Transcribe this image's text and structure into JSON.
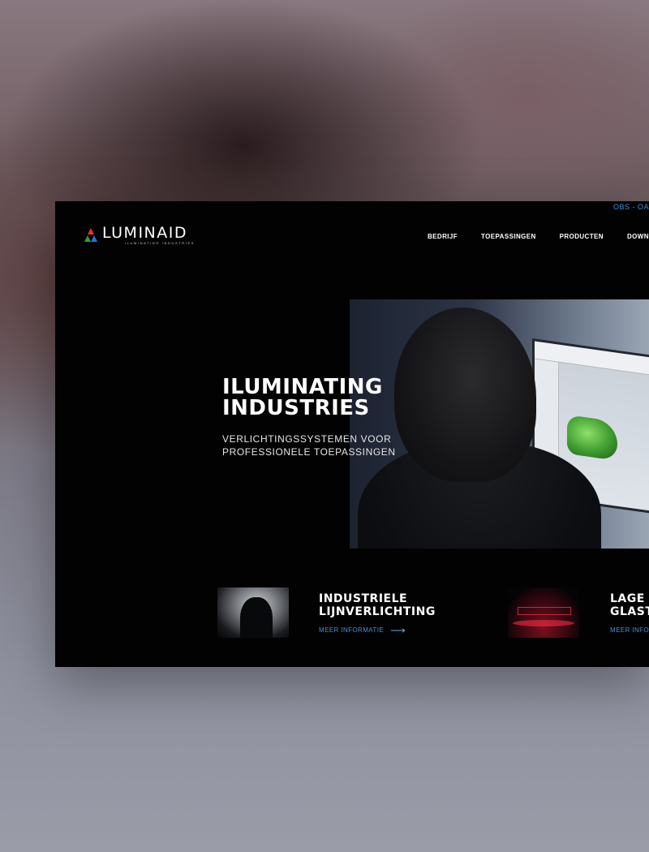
{
  "topbar": {
    "link_text": "OBS - OA"
  },
  "header": {
    "logo": {
      "name": "LUMINAID",
      "tagline": "ILUMINATING INDUSTRIES"
    },
    "nav": [
      {
        "label": "BEDRIJF"
      },
      {
        "label": "TOEPASSINGEN"
      },
      {
        "label": "PRODUCTEN"
      },
      {
        "label": "DOWNLO"
      }
    ]
  },
  "hero": {
    "title": "ILUMINATING\nINDUSTRIES",
    "subtitle": "VERLICHTINGSSYSTEMEN VOOR\nPROFESSIONELE TOEPASSINGEN"
  },
  "cards": [
    {
      "title": "INDUSTRIELE\nLIJNVERLICHTING",
      "link": "MEER INFORMATIE"
    },
    {
      "title": "LAGE\nGLAST",
      "link": "MEER INFOR"
    }
  ],
  "colors": {
    "background": "#020203",
    "accent": "#4a90d9",
    "text": "#ffffff"
  }
}
